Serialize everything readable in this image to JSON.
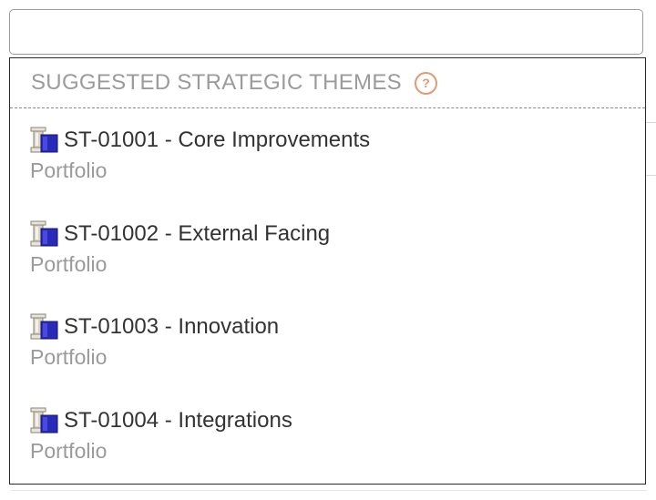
{
  "search": {
    "value": "",
    "placeholder": ""
  },
  "dropdown": {
    "title": "SUGGESTED STRATEGIC THEMES",
    "help_icon": "help-question-icon",
    "help_glyph": "?",
    "items": [
      {
        "id_title": "ST-01001 - Core Improvements",
        "subtitle": "Portfolio",
        "icon": "strategic-theme-icon"
      },
      {
        "id_title": "ST-01002 - External Facing",
        "subtitle": "Portfolio",
        "icon": "strategic-theme-icon"
      },
      {
        "id_title": "ST-01003 - Innovation",
        "subtitle": "Portfolio",
        "icon": "strategic-theme-icon"
      },
      {
        "id_title": "ST-01004 - Integrations",
        "subtitle": "Portfolio",
        "icon": "strategic-theme-icon"
      }
    ]
  },
  "colors": {
    "accent_help": "#e39a73",
    "title_gray": "#9b9b9b",
    "text_dark": "#333333",
    "icon_blue": "#2a2ab8"
  }
}
